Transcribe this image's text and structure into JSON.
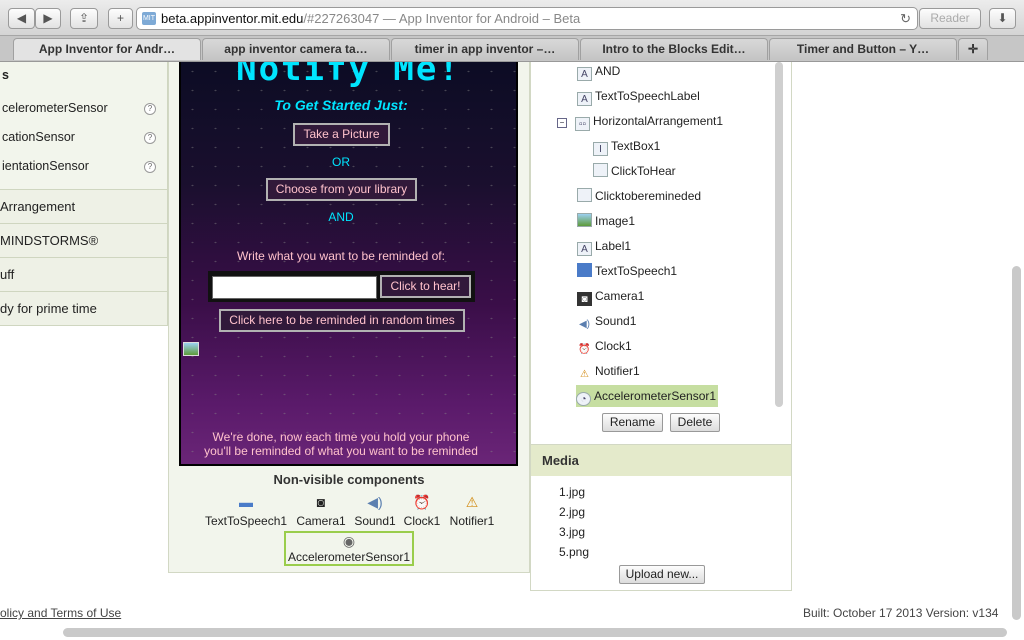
{
  "browser": {
    "url_host": "beta.appinventor.mit.edu",
    "url_rest": "/#227263047",
    "page_title": " — App Inventor for Android – Beta",
    "reader_label": "Reader",
    "tabs": [
      "App Inventor for Andr…",
      "app inventor camera ta…",
      "timer in app inventor –…",
      "Intro to the Blocks Edit…",
      "Timer and Button – Y…"
    ]
  },
  "palette": {
    "header_fragment": "s",
    "sensors": [
      "celerometerSensor",
      "cationSensor",
      "ientationSensor"
    ],
    "help_glyph": "?",
    "categories": [
      "Arrangement",
      " MINDSTORMS®",
      "uff",
      "dy for prime time"
    ]
  },
  "viewer": {
    "title": "Notify Me!",
    "subtitle": "To Get Started Just:",
    "take_picture": "Take a Picture",
    "or_label": "OR",
    "choose_library": "Choose from your library",
    "and_label": "AND",
    "write_prompt": "Write what you want to be reminded of:",
    "textbox_value": "",
    "click_to_hear": "Click to hear!",
    "random_reminder": "Click here to be reminded in random times",
    "done_line1": "We're done, now each time you hold your phone",
    "done_line2": "you'll be reminded of what you want to be reminded"
  },
  "nonvisible": {
    "title": "Non-visible components",
    "items": [
      {
        "label": "TextToSpeech1",
        "icon": "speech-icon"
      },
      {
        "label": "Camera1",
        "icon": "camera-icon"
      },
      {
        "label": "Sound1",
        "icon": "speaker-icon"
      },
      {
        "label": "Clock1",
        "icon": "clock-icon"
      },
      {
        "label": "Notifier1",
        "icon": "warning-icon"
      }
    ],
    "selected": "AccelerometerSensor1"
  },
  "tree": {
    "nodes": [
      {
        "label": "AND",
        "icon": "label-icon"
      },
      {
        "label": "TextToSpeechLabel",
        "icon": "label-icon"
      },
      {
        "label": "HorizontalArrangement1",
        "icon": "arrangement-icon",
        "expand": "⊟"
      },
      {
        "label": "TextBox1",
        "icon": "textbox-icon"
      },
      {
        "label": "ClickToHear",
        "icon": "button-icon"
      },
      {
        "label": "Clicktoberemineded",
        "icon": "button-icon"
      },
      {
        "label": "Image1",
        "icon": "image-icon"
      },
      {
        "label": "Label1",
        "icon": "label-icon"
      },
      {
        "label": "TextToSpeech1",
        "icon": "speech-icon"
      },
      {
        "label": "Camera1",
        "icon": "camera-icon"
      },
      {
        "label": "Sound1",
        "icon": "speaker-icon"
      },
      {
        "label": "Clock1",
        "icon": "clock-icon"
      },
      {
        "label": "Notifier1",
        "icon": "warning-icon"
      },
      {
        "label": "AccelerometerSensor1",
        "icon": "accelerometer-icon"
      }
    ],
    "rename": "Rename",
    "delete": "Delete"
  },
  "media": {
    "title": "Media",
    "files": [
      "1.jpg",
      "2.jpg",
      "3.jpg",
      "5.png"
    ],
    "upload": "Upload new..."
  },
  "footer": {
    "left": "olicy and Terms of Use",
    "right": "Built: October 17 2013 Version: v134"
  },
  "colors": {
    "cyan": "#00e5ff",
    "pink": "#ffc2cc",
    "selected_green": "#c6dea1",
    "panel_green": "#e4eacb"
  }
}
